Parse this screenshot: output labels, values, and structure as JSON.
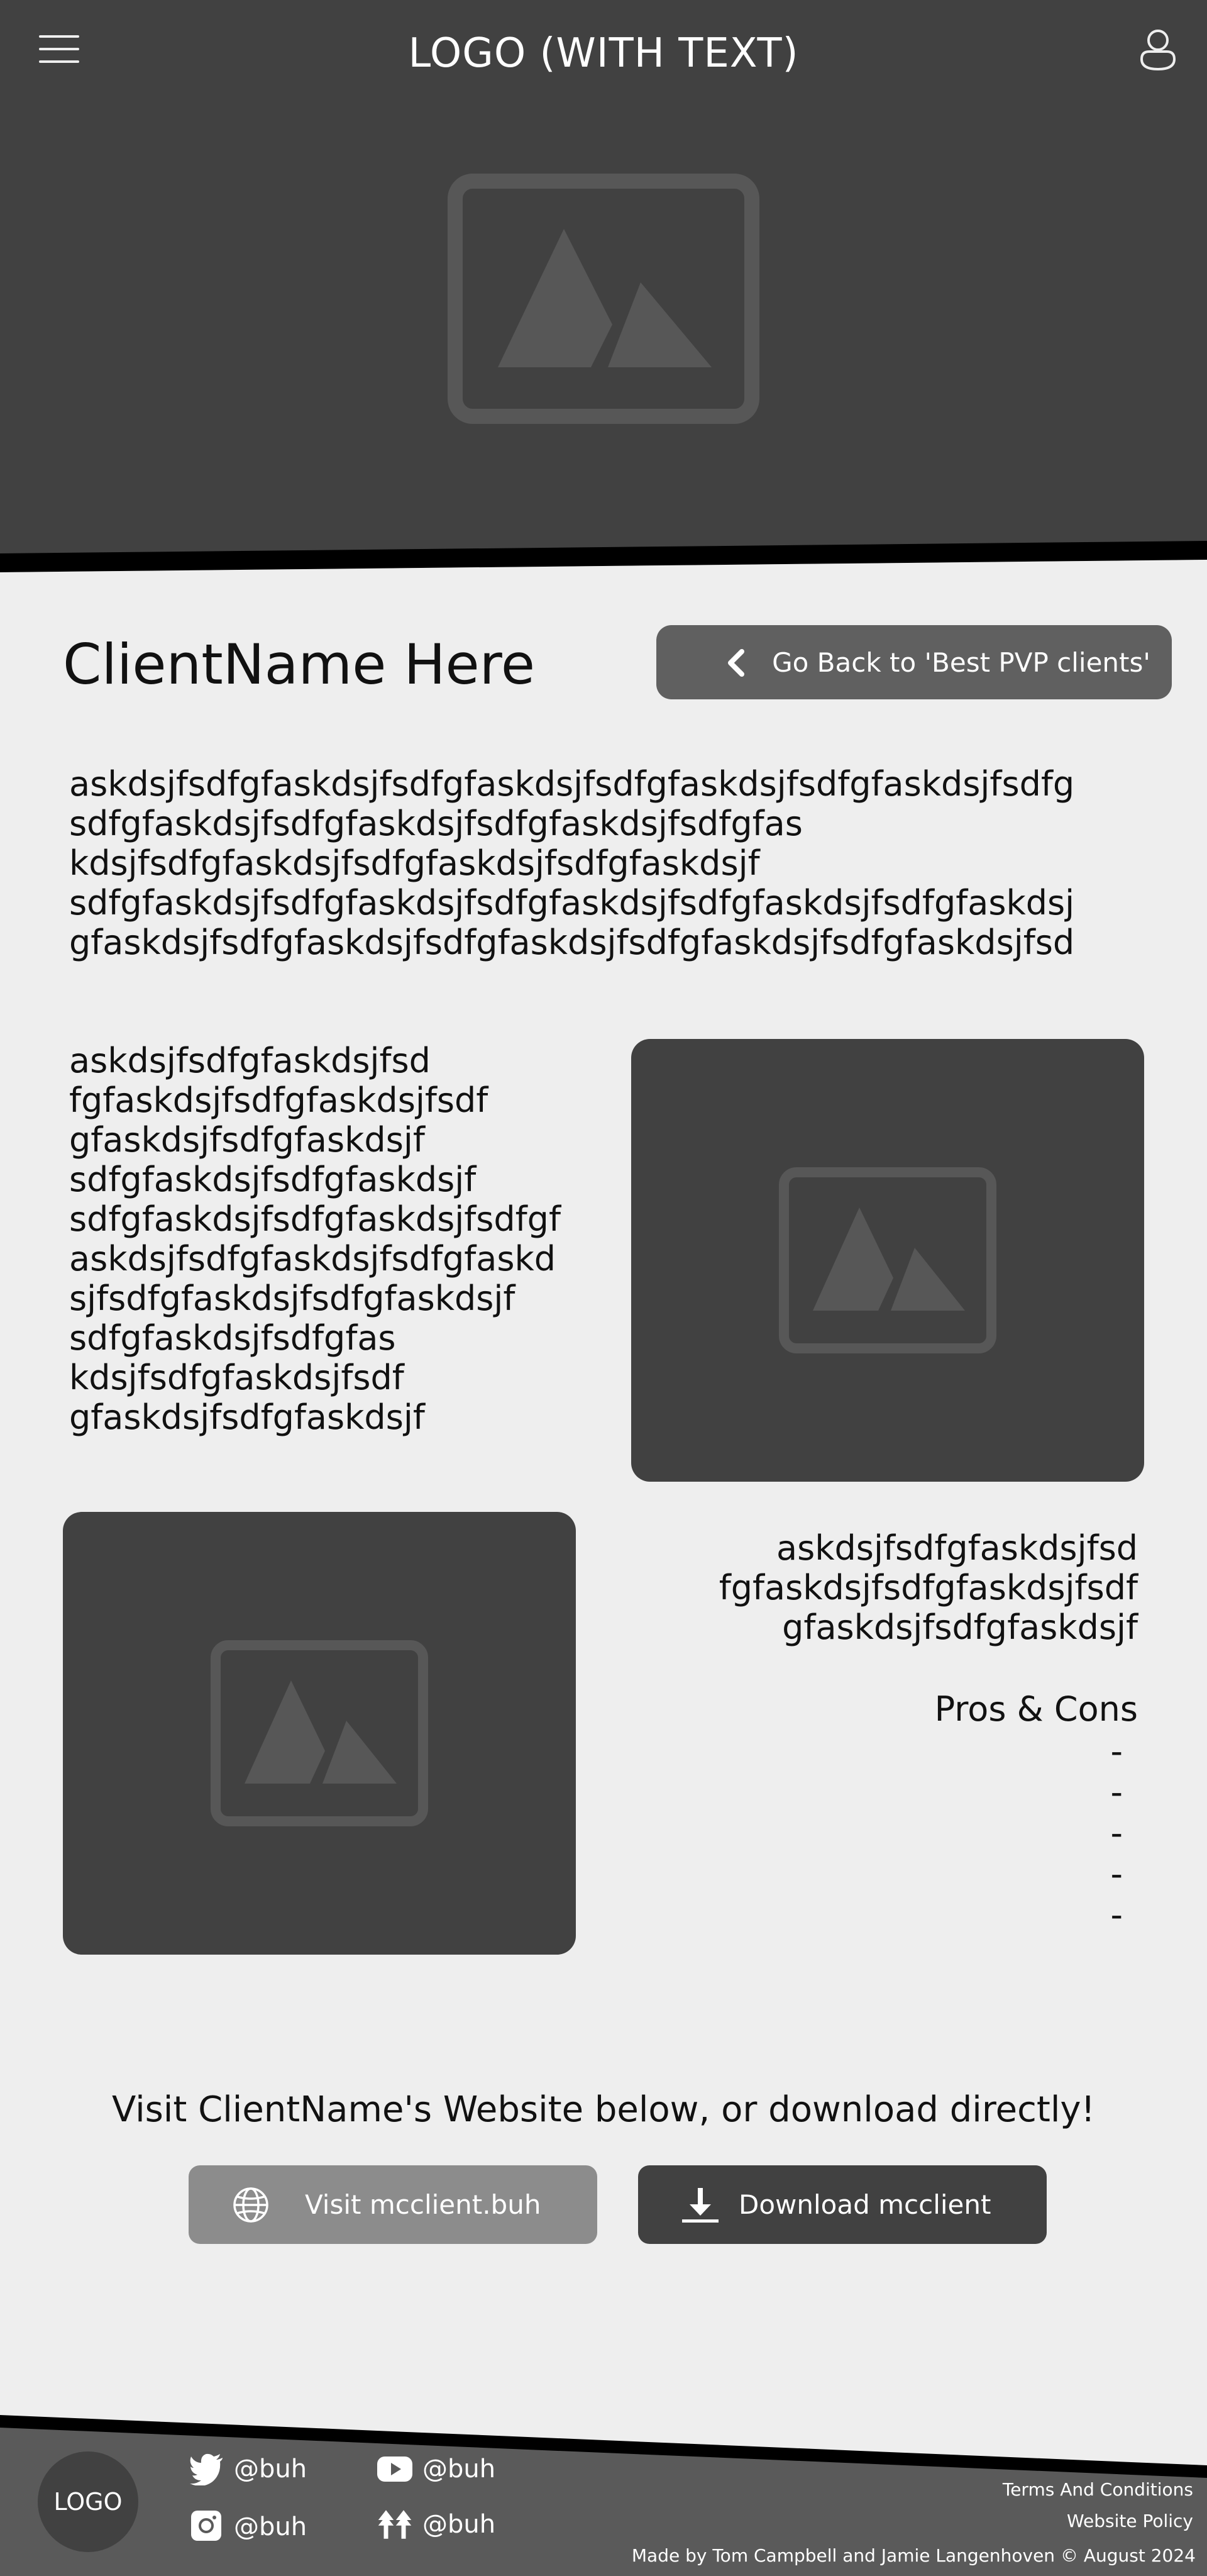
{
  "header": {
    "logo_text": "LOGO (WITH TEXT)"
  },
  "client": {
    "name": "ClientName Here",
    "back_label": "Go Back to 'Best PVP clients'"
  },
  "content": {
    "paragraph_1": "askdsjfsdfgfaskdsjfsdfgfaskdsjfsdfgfaskdsjfsdfgfaskdsjfsdfg\nsdfgfaskdsjfsdfgfaskdsjfsdfgfaskdsjfsdfgfas\nkdsjfsdfgfaskdsjfsdfgfaskdsjfsdfgfaskdsjf\nsdfgfaskdsjfsdfgfaskdsjfsdfgfaskdsjfsdfgfaskdsjfsdfgfaskdsj\ngfaskdsjfsdfgfaskdsjfsdfgfaskdsjfsdfgfaskdsjfsdfgfaskdsjfsd",
    "paragraph_2": "askdsjfsdfgfaskdsjfsd\nfgfaskdsjfsdfgfaskdsjfsdf\ngfaskdsjfsdfgfaskdsjf\nsdfgfaskdsjfsdfgfaskdsjf\nsdfgfaskdsjfsdfgfaskdsjfsdfgf\naskdsjfsdfgfaskdsjfsdfgfaskd\nsjfsdfgfaskdsjfsdfgfaskdsjf\nsdfgfaskdsjfsdfgfas\nkdsjfsdfgfaskdsjfsdf\ngfaskdsjfsdfgfaskdsjf",
    "paragraph_3": "askdsjfsdfgfaskdsjfsd\nfgfaskdsjfsdfgfaskdsjfsdf\ngfaskdsjfsdfgfaskdsjf",
    "pros_cons_title": "Pros & Cons",
    "pros_cons_items": [
      "-",
      "-",
      "-",
      "-",
      "-"
    ]
  },
  "cta": {
    "text": "Visit ClientName's Website below, or download directly!",
    "visit_label": "Visit mcclient.buh",
    "download_label": "Download mcclient"
  },
  "footer": {
    "logo": "LOGO",
    "twitter_handle": "@buh",
    "youtube_handle": "@buh",
    "instagram_handle": "@buh",
    "linktree_handle": "@buh",
    "terms": "Terms And Conditions",
    "policy": "Website Policy",
    "credit": "Made by Tom Campbell and Jamie Langenhoven © August 2024"
  },
  "colors": {
    "dark": "#414141",
    "background": "#eeeeee",
    "button_grey": "#606060",
    "visit_grey": "#8c8c8c",
    "footer_grey": "#5a5a5a"
  }
}
